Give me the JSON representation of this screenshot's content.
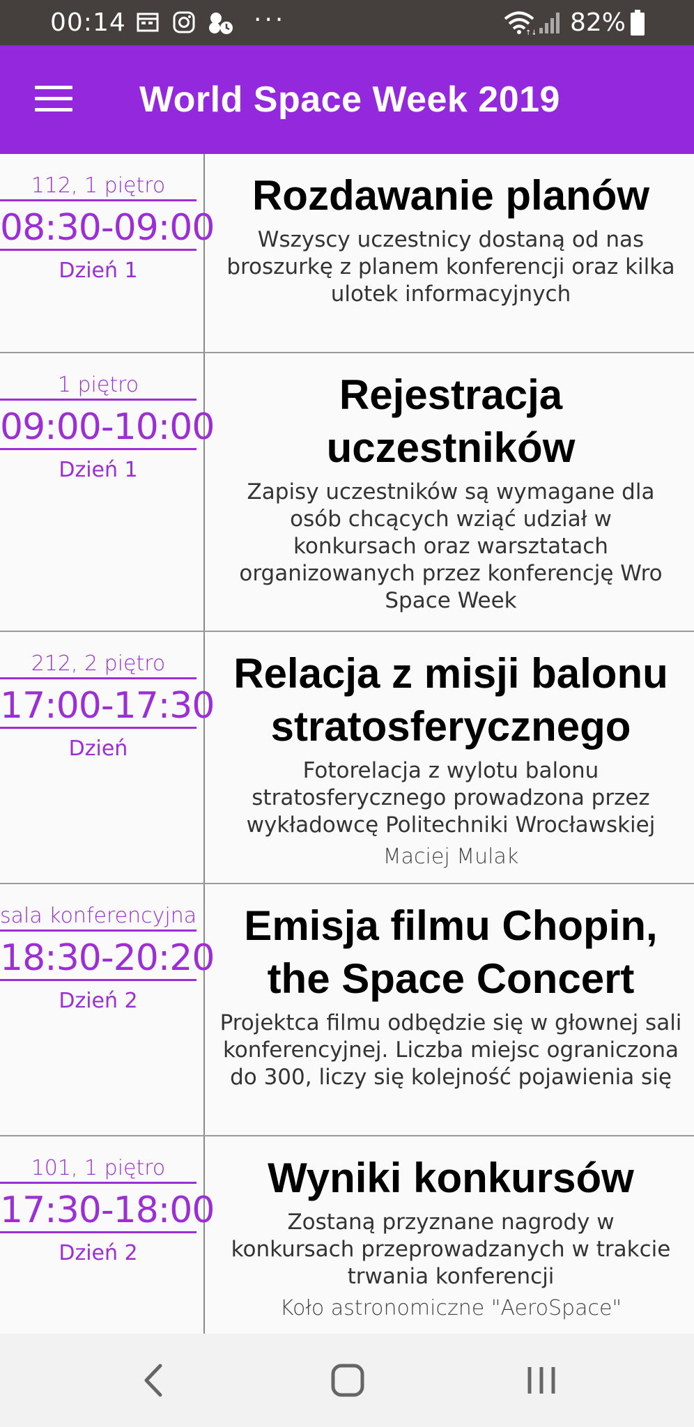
{
  "status_bar": {
    "time": "00:14",
    "battery": "82%",
    "icons": [
      "calendar-icon",
      "instagram-icon",
      "app-notification-icon",
      "more-dots-icon",
      "wifi-icon",
      "signal-icon",
      "battery-icon"
    ],
    "dots": "···"
  },
  "app_bar": {
    "title": "World Space Week 2019",
    "menu_icon": "menu-icon",
    "color": "#9328dc"
  },
  "events": [
    {
      "room": "112, 1 piętro",
      "time": "08:30-09:00",
      "day": "Dzień 1",
      "title": "Rozdawanie planów",
      "description": "Wszyscy uczestnicy dostaną od nas broszurkę z planem konferencji oraz kilka ulotek informacyjnych",
      "speaker": ""
    },
    {
      "room": "1 piętro",
      "time": "09:00-10:00",
      "day": "Dzień 1",
      "title": "Rejestracja uczestników",
      "description": "Zapisy uczestników są wymagane dla osób chcących wziąć udział w konkursach oraz warsztatach organizowanych przez konferencję Wro Space Week",
      "speaker": ""
    },
    {
      "room": "212, 2 piętro",
      "time": "17:00-17:30",
      "day": "Dzień",
      "title": "Relacja z misji balonu stratosferycznego",
      "description": "Fotorelacja z wylotu balonu stratosferycznego prowadzona przez wykładowcę Politechniki Wrocławskiej",
      "speaker": "Maciej Mulak"
    },
    {
      "room": "sala konferencyjna",
      "time": "18:30-20:20",
      "day": "Dzień 2",
      "title": "Emisja filmu Chopin, the Space Concert",
      "description": "Projektca filmu odbędzie się w głownej sali konferencyjnej. Liczba miejsc ograniczona do 300, liczy się kolejność pojawienia się",
      "speaker": ""
    },
    {
      "room": "101, 1 piętro",
      "time": "17:30-18:00",
      "day": "Dzień 2",
      "title": "Wyniki konkursów",
      "description": "Zostaną przyznane nagrody w konkursach przeprowadzanych w trakcie trwania konferencji",
      "speaker": "Koło astronomiczne \"AeroSpace\""
    }
  ],
  "nav_bar": {
    "icons": [
      "back-icon",
      "home-icon",
      "recent-apps-icon"
    ]
  },
  "colors": {
    "accent": "#9b2fd3",
    "status_bar": "#45403e"
  }
}
